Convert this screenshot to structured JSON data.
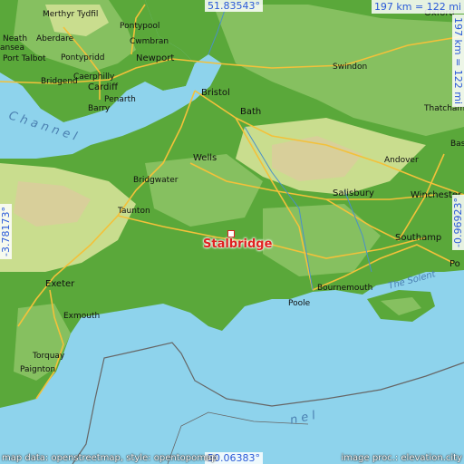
{
  "colors": {
    "sea": "#8ed3ec",
    "land_low": "#5aa83a",
    "land_mid": "#86c060",
    "land_high": "#c9dd8e",
    "hill": "#d8cf9a",
    "road": "#f3c13a",
    "marker": "#e02020",
    "coord_text": "#2a5ad8"
  },
  "coords": {
    "top": "51.83543°",
    "bottom": "50.06383°",
    "left": "-3.78173°",
    "right": "-0.96923°"
  },
  "scale": {
    "horizontal": "197 km = 122 mi",
    "vertical": "197 km = 122 mi"
  },
  "place": {
    "name": "Stalbridge"
  },
  "credits": {
    "left": "map data: openstreetmap, style: opentopomap",
    "right": "image proc.: elevation.city"
  },
  "towns": [
    {
      "id": "merthyr",
      "name": "Merthyr Tydfil"
    },
    {
      "id": "neath",
      "name": "Neath"
    },
    {
      "id": "aberdare",
      "name": "Aberdare"
    },
    {
      "id": "pontypool",
      "name": "Pontypool"
    },
    {
      "id": "cwmbran",
      "name": "Cwmbran"
    },
    {
      "id": "swansea",
      "name": "ansea"
    },
    {
      "id": "porttalbot",
      "name": "Port Talbot"
    },
    {
      "id": "pontypridd",
      "name": "Pontypridd"
    },
    {
      "id": "newport",
      "name": "Newport"
    },
    {
      "id": "caerphilly",
      "name": "Caerphilly"
    },
    {
      "id": "cardiff",
      "name": "Cardiff"
    },
    {
      "id": "bridgend",
      "name": "Bridgend"
    },
    {
      "id": "penarth",
      "name": "Penarth"
    },
    {
      "id": "barry",
      "name": "Barry"
    },
    {
      "id": "bristol",
      "name": "Bristol"
    },
    {
      "id": "bath",
      "name": "Bath"
    },
    {
      "id": "swindon",
      "name": "Swindon"
    },
    {
      "id": "oxford",
      "name": "Oxford"
    },
    {
      "id": "thatcham",
      "name": "Thatcham"
    },
    {
      "id": "wells",
      "name": "Wells"
    },
    {
      "id": "andover",
      "name": "Andover"
    },
    {
      "id": "bridgwater",
      "name": "Bridgwater"
    },
    {
      "id": "salisbury",
      "name": "Salisbury"
    },
    {
      "id": "winchester",
      "name": "Winchester"
    },
    {
      "id": "taunton",
      "name": "Taunton"
    },
    {
      "id": "southampton",
      "name": "Southamp"
    },
    {
      "id": "exeter",
      "name": "Exeter"
    },
    {
      "id": "bournemouth",
      "name": "Bournemouth"
    },
    {
      "id": "poole",
      "name": "Poole"
    },
    {
      "id": "exmouth",
      "name": "Exmouth"
    },
    {
      "id": "torquay",
      "name": "Torquay"
    },
    {
      "id": "paignton",
      "name": "Paignton"
    },
    {
      "id": "portsmouth",
      "name": "Po"
    },
    {
      "id": "bas",
      "name": "Bas"
    }
  ],
  "water_labels": {
    "channel_top": "C h a n n e l",
    "solent": "The Solent",
    "channel_bottom": "n   e   l"
  }
}
